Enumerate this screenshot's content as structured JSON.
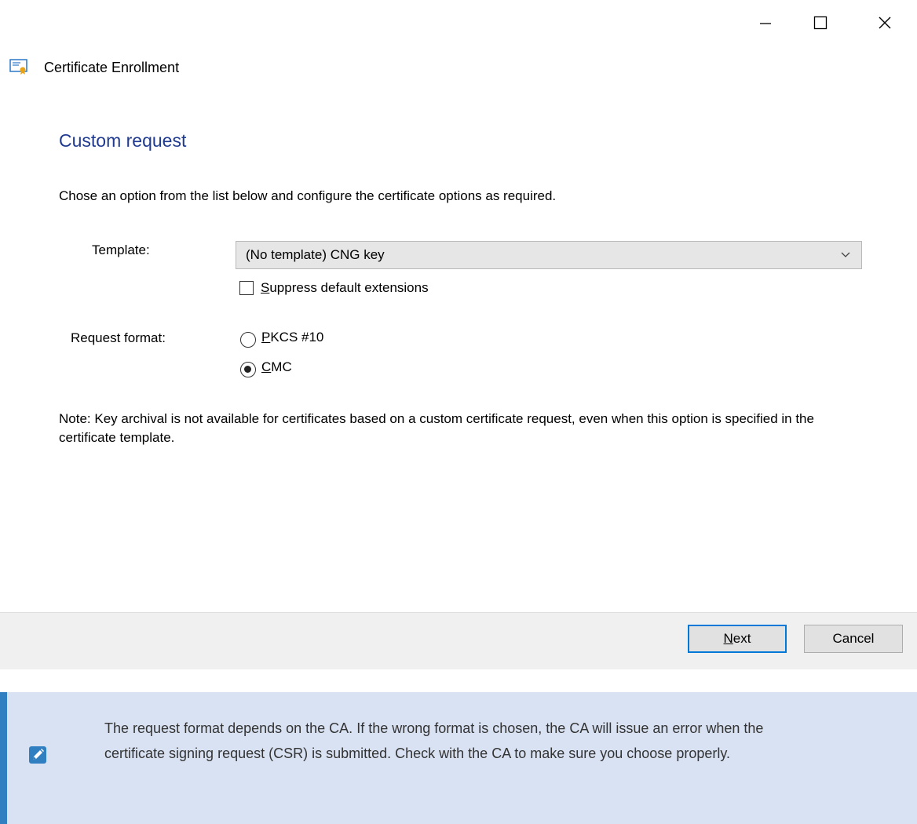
{
  "window": {
    "title": "Certificate Enrollment",
    "controls": [
      "minimize-icon",
      "maximize-icon",
      "close-icon"
    ]
  },
  "page": {
    "heading": "Custom request",
    "instructions": "Chose an option from the list below and configure the certificate options as required."
  },
  "template": {
    "label": "Template:",
    "selected": "(No template) CNG key",
    "suppress_checked": false,
    "suppress_pre": "",
    "suppress_mnemonic": "S",
    "suppress_post": "uppress default extensions"
  },
  "request_format": {
    "label": "Request format:",
    "selected": "CMC",
    "pkcs_mnemonic": "P",
    "pkcs_post": "KCS #10",
    "cmc_mnemonic": "C",
    "cmc_post": "MC"
  },
  "note": "Note: Key archival is not available for certificates based on a custom certificate request, even when this option is specified in the certificate template.",
  "buttons": {
    "next_mnemonic": "N",
    "next_post": "ext",
    "cancel": "Cancel"
  },
  "callout": {
    "text": "The request format depends on the CA. If the wrong format is chosen, the CA will issue an error when the certificate signing request (CSR) is submitted. Check with the CA to make sure you choose properly.",
    "icon": "pencil-icon",
    "colors": {
      "background": "#d9e2f3",
      "accent": "#2f7fc1"
    }
  },
  "colors": {
    "heading": "#1f3a8f",
    "default_button_border": "#0078d7"
  }
}
